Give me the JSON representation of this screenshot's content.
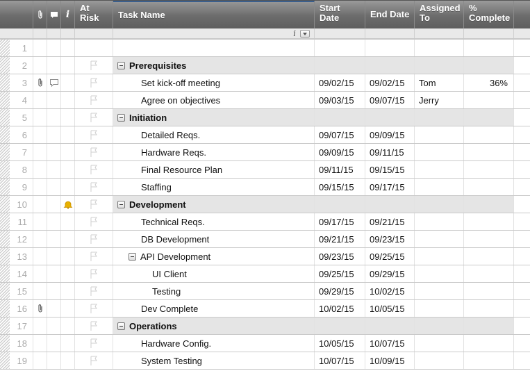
{
  "header": {
    "at_risk": "At Risk",
    "task_name": "Task Name",
    "start_date": "Start Date",
    "end_date": "End Date",
    "assigned_to": "Assigned To",
    "percent_complete": "% Complete",
    "icons": [
      "attachment-icon",
      "comment-icon",
      "info-icon"
    ]
  },
  "colors": {
    "section_bg": "#e5e5e5",
    "header_bg": "#6c6c6c",
    "bell": "#e8b100"
  },
  "rows": [
    {
      "num": "1",
      "task": "",
      "level": 0,
      "section": false,
      "start": "",
      "end": "",
      "assigned": "",
      "pct": "",
      "attachment": false,
      "comment": false,
      "reminder": false,
      "flag": false
    },
    {
      "num": "2",
      "task": "Prerequisites",
      "level": 0,
      "section": true,
      "start": "",
      "end": "",
      "assigned": "",
      "pct": "",
      "attachment": false,
      "comment": false,
      "reminder": false,
      "flag": true
    },
    {
      "num": "3",
      "task": "Set kick-off meeting",
      "level": 1,
      "section": false,
      "start": "09/02/15",
      "end": "09/02/15",
      "assigned": "Tom",
      "pct": "36%",
      "attachment": true,
      "comment": true,
      "reminder": false,
      "flag": true
    },
    {
      "num": "4",
      "task": "Agree on objectives",
      "level": 1,
      "section": false,
      "start": "09/03/15",
      "end": "09/07/15",
      "assigned": "Jerry",
      "pct": "",
      "attachment": false,
      "comment": false,
      "reminder": false,
      "flag": true
    },
    {
      "num": "5",
      "task": "Initiation",
      "level": 0,
      "section": true,
      "start": "",
      "end": "",
      "assigned": "",
      "pct": "",
      "attachment": false,
      "comment": false,
      "reminder": false,
      "flag": true
    },
    {
      "num": "6",
      "task": "Detailed Reqs.",
      "level": 1,
      "section": false,
      "start": "09/07/15",
      "end": "09/09/15",
      "assigned": "",
      "pct": "",
      "attachment": false,
      "comment": false,
      "reminder": false,
      "flag": true
    },
    {
      "num": "7",
      "task": "Hardware Reqs.",
      "level": 1,
      "section": false,
      "start": "09/09/15",
      "end": "09/11/15",
      "assigned": "",
      "pct": "",
      "attachment": false,
      "comment": false,
      "reminder": false,
      "flag": true
    },
    {
      "num": "8",
      "task": "Final Resource Plan",
      "level": 1,
      "section": false,
      "start": "09/11/15",
      "end": "09/15/15",
      "assigned": "",
      "pct": "",
      "attachment": false,
      "comment": false,
      "reminder": false,
      "flag": true
    },
    {
      "num": "9",
      "task": "Staffing",
      "level": 1,
      "section": false,
      "start": "09/15/15",
      "end": "09/17/15",
      "assigned": "",
      "pct": "",
      "attachment": false,
      "comment": false,
      "reminder": false,
      "flag": true
    },
    {
      "num": "10",
      "task": "Development",
      "level": 0,
      "section": true,
      "start": "",
      "end": "",
      "assigned": "",
      "pct": "",
      "attachment": false,
      "comment": false,
      "reminder": true,
      "flag": true
    },
    {
      "num": "11",
      "task": "Technical Reqs.",
      "level": 1,
      "section": false,
      "start": "09/17/15",
      "end": "09/21/15",
      "assigned": "",
      "pct": "",
      "attachment": false,
      "comment": false,
      "reminder": false,
      "flag": true
    },
    {
      "num": "12",
      "task": "DB Development",
      "level": 1,
      "section": false,
      "start": "09/21/15",
      "end": "09/23/15",
      "assigned": "",
      "pct": "",
      "attachment": false,
      "comment": false,
      "reminder": false,
      "flag": true
    },
    {
      "num": "13",
      "task": "API Development",
      "level": 1,
      "section": false,
      "parent": true,
      "start": "09/23/15",
      "end": "09/25/15",
      "assigned": "",
      "pct": "",
      "attachment": false,
      "comment": false,
      "reminder": false,
      "flag": true
    },
    {
      "num": "14",
      "task": "UI Client",
      "level": 2,
      "section": false,
      "start": "09/25/15",
      "end": "09/29/15",
      "assigned": "",
      "pct": "",
      "attachment": false,
      "comment": false,
      "reminder": false,
      "flag": true
    },
    {
      "num": "15",
      "task": "Testing",
      "level": 2,
      "section": false,
      "start": "09/29/15",
      "end": "10/02/15",
      "assigned": "",
      "pct": "",
      "attachment": false,
      "comment": false,
      "reminder": false,
      "flag": true
    },
    {
      "num": "16",
      "task": "Dev Complete",
      "level": 1,
      "section": false,
      "start": "10/02/15",
      "end": "10/05/15",
      "assigned": "",
      "pct": "",
      "attachment": true,
      "comment": false,
      "reminder": false,
      "flag": true
    },
    {
      "num": "17",
      "task": "Operations",
      "level": 0,
      "section": true,
      "start": "",
      "end": "",
      "assigned": "",
      "pct": "",
      "attachment": false,
      "comment": false,
      "reminder": false,
      "flag": true
    },
    {
      "num": "18",
      "task": "Hardware Config.",
      "level": 1,
      "section": false,
      "start": "10/05/15",
      "end": "10/07/15",
      "assigned": "",
      "pct": "",
      "attachment": false,
      "comment": false,
      "reminder": false,
      "flag": true
    },
    {
      "num": "19",
      "task": "System Testing",
      "level": 1,
      "section": false,
      "start": "10/07/15",
      "end": "10/09/15",
      "assigned": "",
      "pct": "",
      "attachment": false,
      "comment": false,
      "reminder": false,
      "flag": true
    }
  ]
}
